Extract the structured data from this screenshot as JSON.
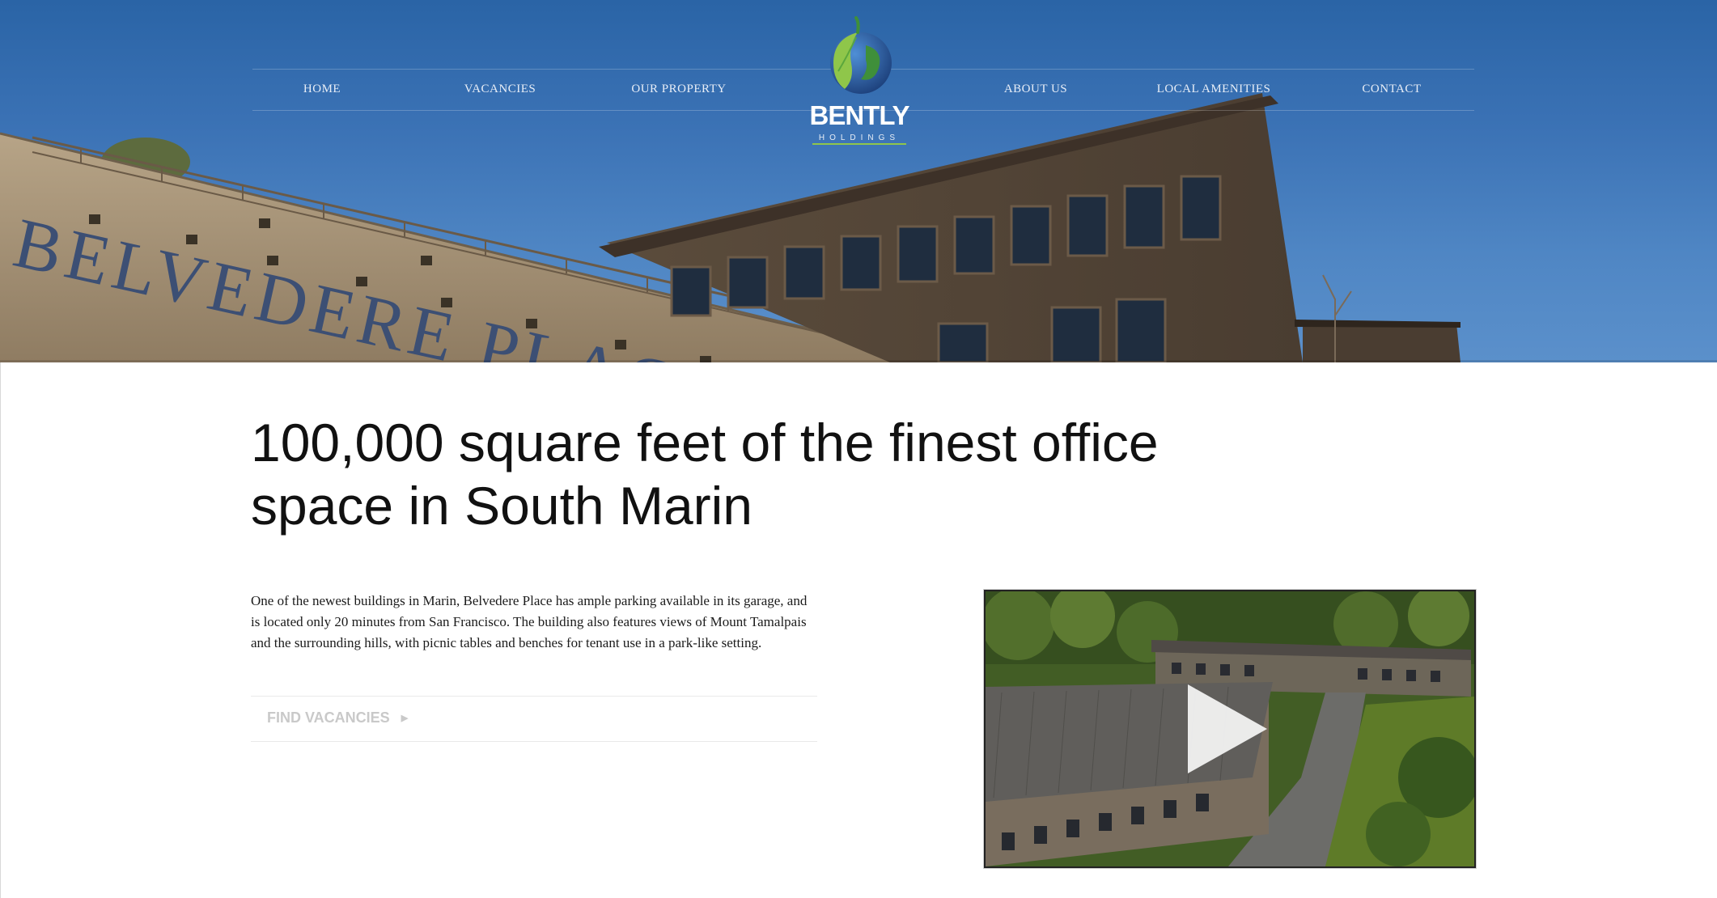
{
  "nav": {
    "left": [
      {
        "label": "HOME"
      },
      {
        "label": "VACANCIES"
      },
      {
        "label": "OUR PROPERTY"
      }
    ],
    "right": [
      {
        "label": "ABOUT US"
      },
      {
        "label": "LOCAL AMENITIES"
      },
      {
        "label": "CONTACT"
      }
    ]
  },
  "logo": {
    "name": "BENTLY",
    "subtitle": "HOLDINGS",
    "icon": "globe-leaf-icon"
  },
  "hero": {
    "sign_text": "BELVEDERE PLACE"
  },
  "main": {
    "headline": "100,000 square feet of the finest office space in South Marin",
    "description": "One of the newest buildings in Marin, Belvedere Place has ample parking available in its garage, and is located only 20 minutes from San Francisco. The building also features views of Mount Tamalpais and the surrounding hills, with picnic tables and benches for tenant use in a park-like setting.",
    "cta_label": "FIND VACANCIES",
    "cta_icon": "play-triangle-icon"
  },
  "video": {
    "play_icon": "play-icon"
  },
  "colors": {
    "sky_top": "#2a64a6",
    "sky_bottom": "#5b90cb",
    "logo_green": "#8fc64a",
    "headline": "#111111",
    "cta_text": "#c9c9c9"
  }
}
